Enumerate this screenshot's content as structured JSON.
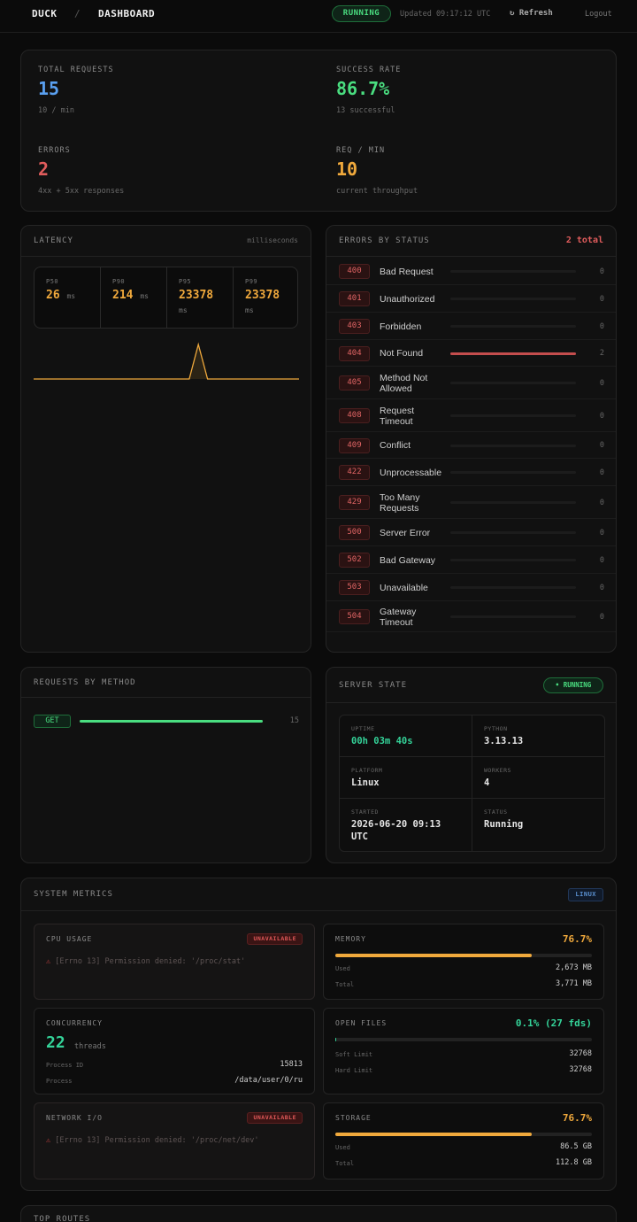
{
  "topbar": {
    "brand": "DUCK",
    "separator": "/",
    "section": "DASHBOARD",
    "status": "RUNNING",
    "updated": "Updated 09:17:12 UTC",
    "refresh": "Refresh",
    "logout": "Logout"
  },
  "summary": {
    "total_requests": {
      "label": "TOTAL REQUESTS",
      "value": "15",
      "sub": "10 / min"
    },
    "success_rate": {
      "label": "SUCCESS RATE",
      "value": "86.7%",
      "sub": "13 successful"
    },
    "errors": {
      "label": "ERRORS",
      "value": "2",
      "sub": "4xx + 5xx responses"
    },
    "req_min": {
      "label": "REQ / MIN",
      "value": "10",
      "sub": "current throughput"
    }
  },
  "latency": {
    "title": "LATENCY",
    "unit_label": "milliseconds",
    "percentiles": [
      {
        "label": "P50",
        "value": "26",
        "unit": "ms"
      },
      {
        "label": "P90",
        "value": "214",
        "unit": "ms"
      },
      {
        "label": "P95",
        "value": "23378",
        "unit": "ms"
      },
      {
        "label": "P99",
        "value": "23378",
        "unit": "ms"
      }
    ],
    "sparkline": [
      0,
      0,
      0,
      0,
      0,
      0,
      0,
      0,
      0,
      0,
      0,
      0,
      0,
      0,
      0,
      0,
      0,
      0,
      1,
      0,
      0,
      0,
      0,
      0,
      0,
      0,
      0,
      0,
      0,
      0
    ]
  },
  "errors_by_status": {
    "title": "ERRORS BY STATUS",
    "total": "2 total",
    "max": 2,
    "rows": [
      {
        "code": "400",
        "name": "Bad Request",
        "count": 0
      },
      {
        "code": "401",
        "name": "Unauthorized",
        "count": 0
      },
      {
        "code": "403",
        "name": "Forbidden",
        "count": 0
      },
      {
        "code": "404",
        "name": "Not Found",
        "count": 2
      },
      {
        "code": "405",
        "name": "Method Not Allowed",
        "count": 0
      },
      {
        "code": "408",
        "name": "Request Timeout",
        "count": 0
      },
      {
        "code": "409",
        "name": "Conflict",
        "count": 0
      },
      {
        "code": "422",
        "name": "Unprocessable",
        "count": 0
      },
      {
        "code": "429",
        "name": "Too Many Requests",
        "count": 0
      },
      {
        "code": "500",
        "name": "Server Error",
        "count": 0
      },
      {
        "code": "502",
        "name": "Bad Gateway",
        "count": 0
      },
      {
        "code": "503",
        "name": "Unavailable",
        "count": 0
      },
      {
        "code": "504",
        "name": "Gateway Timeout",
        "count": 0
      }
    ]
  },
  "requests_by_method": {
    "title": "REQUESTS BY METHOD",
    "rows": [
      {
        "method": "GET",
        "count": 15,
        "fraction": 1.0
      }
    ]
  },
  "server_state": {
    "title": "SERVER STATE",
    "badge": "• RUNNING",
    "uptime": {
      "label": "UPTIME",
      "value": "00h 03m 40s"
    },
    "python": {
      "label": "PYTHON",
      "value": "3.13.13"
    },
    "platform": {
      "label": "PLATFORM",
      "value": "Linux"
    },
    "workers": {
      "label": "WORKERS",
      "value": "4"
    },
    "started": {
      "label": "STARTED",
      "value": "2026-06-20 09:13 UTC"
    },
    "status": {
      "label": "STATUS",
      "value": "Running"
    }
  },
  "system_metrics": {
    "title": "SYSTEM METRICS",
    "badge": "LINUX",
    "cpu": {
      "title": "CPU USAGE",
      "badge": "UNAVAILABLE",
      "error": "[Errno 13] Permission denied: '/proc/stat'"
    },
    "memory": {
      "title": "MEMORY",
      "percent": "76.7%",
      "fraction": 0.767,
      "used_label": "Used",
      "used": "2,673 MB",
      "total_label": "Total",
      "total": "3,771 MB"
    },
    "concurrency": {
      "title": "CONCURRENCY",
      "value": "22",
      "unit": "threads",
      "pid_label": "Process ID",
      "pid": "15813",
      "process_label": "Process",
      "process": "/data/user/0/ru"
    },
    "open_files": {
      "title": "OPEN FILES",
      "percent": "0.1% (27 fds)",
      "fraction": 0.001,
      "soft_label": "Soft Limit",
      "soft": "32768",
      "hard_label": "Hard Limit",
      "hard": "32768"
    },
    "network": {
      "title": "NETWORK I/O",
      "badge": "UNAVAILABLE",
      "error": "[Errno 13] Permission denied: '/proc/net/dev'"
    },
    "storage": {
      "title": "STORAGE",
      "percent": "76.7%",
      "fraction": 0.767,
      "used_label": "Used",
      "used": "86.5 GB",
      "total_label": "Total",
      "total": "112.8 GB"
    }
  },
  "top_routes": {
    "title": "TOP ROUTES"
  },
  "colors": {
    "blue": "#5aa0f0",
    "green": "#4ade80",
    "red": "#e05c5c",
    "orange": "#f0a93c",
    "teal": "#34d399"
  }
}
